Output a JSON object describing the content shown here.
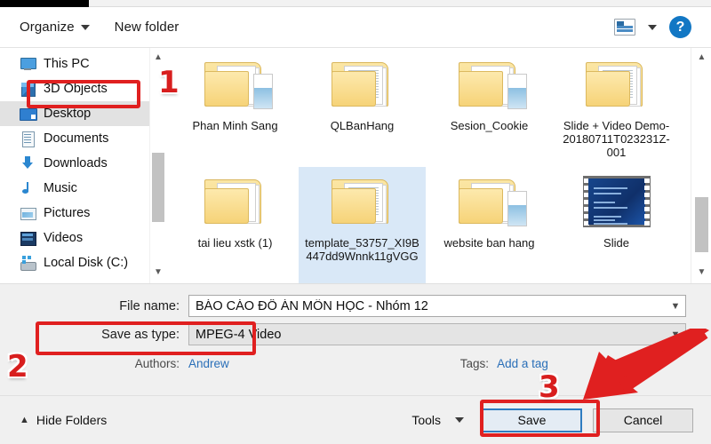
{
  "toolbar": {
    "organize_label": "Organize",
    "new_folder_label": "New folder",
    "view_icon": "view-mode-icon",
    "view_caret_icon": "chevron-down-icon",
    "help_label": "?"
  },
  "sidebar": {
    "items": [
      {
        "label": "This PC",
        "icon": "this-pc-icon",
        "selected": false
      },
      {
        "label": "3D Objects",
        "icon": "3d-objects-icon",
        "selected": false
      },
      {
        "label": "Desktop",
        "icon": "desktop-icon",
        "selected": true
      },
      {
        "label": "Documents",
        "icon": "documents-icon",
        "selected": false
      },
      {
        "label": "Downloads",
        "icon": "downloads-icon",
        "selected": false
      },
      {
        "label": "Music",
        "icon": "music-icon",
        "selected": false
      },
      {
        "label": "Pictures",
        "icon": "pictures-icon",
        "selected": false
      },
      {
        "label": "Videos",
        "icon": "videos-icon",
        "selected": false
      },
      {
        "label": "Local Disk (C:)",
        "icon": "local-disk-icon",
        "selected": false
      }
    ],
    "scroll_up_icon": "chevron-up-icon",
    "scroll_down_icon": "chevron-down-icon"
  },
  "files": {
    "items": [
      {
        "name": "Phan Minh Sang",
        "kind": "folder-image",
        "selected": false
      },
      {
        "name": "QLBanHang",
        "kind": "folder-lines",
        "selected": false
      },
      {
        "name": "Sesion_Cookie",
        "kind": "folder-image",
        "selected": false
      },
      {
        "name": "Slide + Video Demo-20180711T023231Z-001",
        "kind": "folder-lines",
        "selected": false
      },
      {
        "name": "tai lieu xstk (1)",
        "kind": "folder-pdf",
        "selected": false
      },
      {
        "name": "template_53757_XI9B447dd9Wnnk11gVGG",
        "kind": "folder-doc",
        "selected": true
      },
      {
        "name": "website ban hang",
        "kind": "folder-image",
        "selected": false
      },
      {
        "name": "Slide",
        "kind": "video",
        "selected": false
      }
    ],
    "scroll_up_icon": "chevron-up-icon",
    "scroll_down_icon": "chevron-down-icon"
  },
  "form": {
    "file_name_label": "File name:",
    "file_name_value": "BÁO CÁO ĐỒ ÁN MÔN HỌC - Nhóm 12",
    "file_name_placeholder": "File name",
    "save_as_type_label": "Save as type:",
    "save_as_type_value": "MPEG-4 Video",
    "authors_label": "Authors:",
    "authors_value": "Andrew",
    "tags_label": "Tags:",
    "tags_value": "Add a tag",
    "dropdown_icon": "chevron-down-icon"
  },
  "footer": {
    "hide_folders_label": "Hide Folders",
    "hide_folders_icon": "chevron-up-icon",
    "tools_label": "Tools",
    "tools_caret_icon": "chevron-down-icon",
    "save_label": "Save",
    "cancel_label": "Cancel"
  },
  "annotations": {
    "step1": "1",
    "step2": "2",
    "step3": "3",
    "highlight_color": "#e02020",
    "arrow_icon": "arrow-pointing-down-left-icon"
  }
}
